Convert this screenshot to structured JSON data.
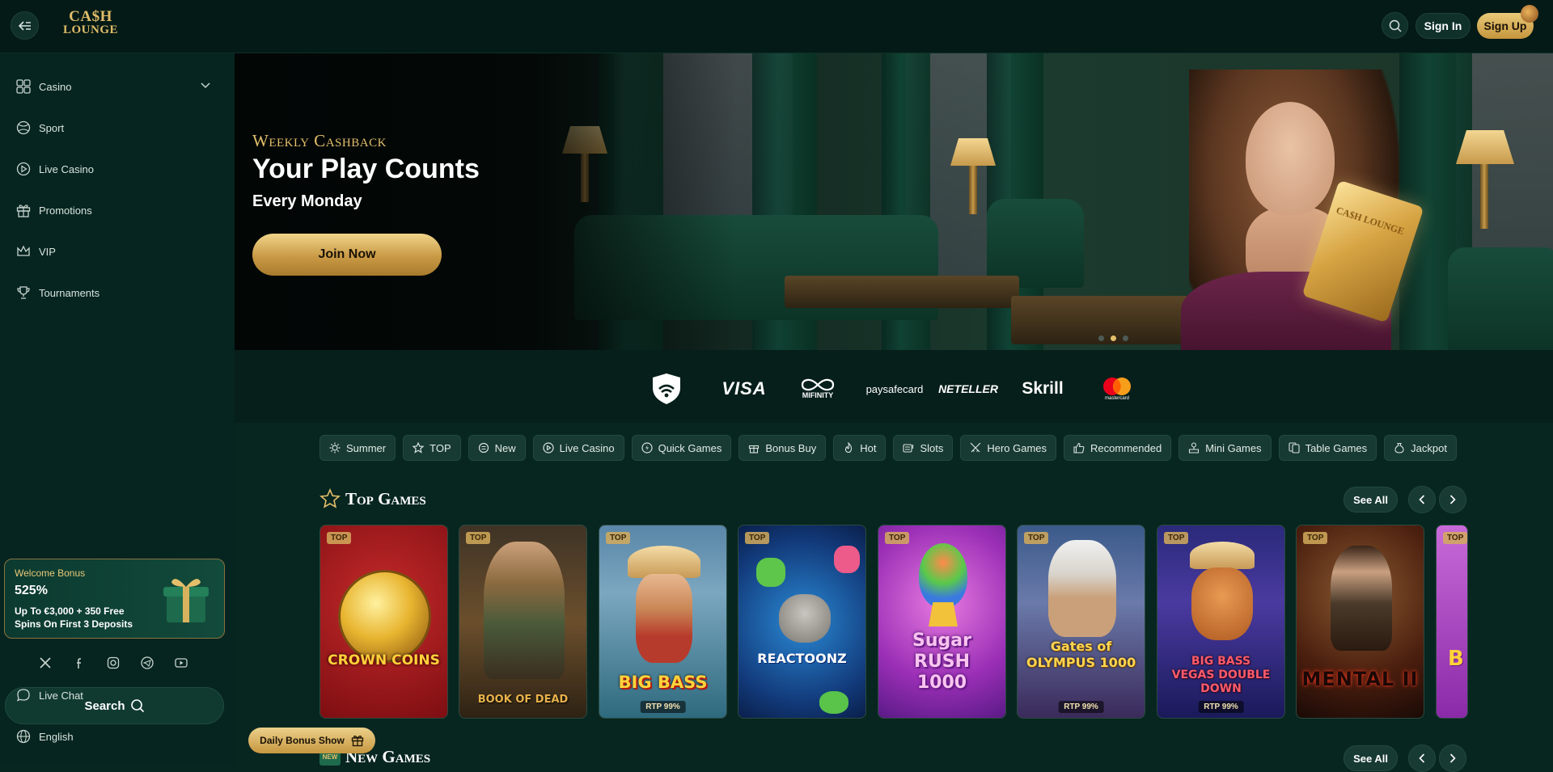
{
  "header": {
    "logo_line1": "CA$H",
    "logo_line2": "LOUNGE",
    "signin_label": "Sign In",
    "signup_label": "Sign Up"
  },
  "sidebar": {
    "items": [
      {
        "label": "Casino",
        "icon": "casino-icon"
      },
      {
        "label": "Sport",
        "icon": "sport-ball-icon"
      },
      {
        "label": "Live Casino",
        "icon": "play-circle-icon"
      },
      {
        "label": "Promotions",
        "icon": "gift-icon"
      },
      {
        "label": "VIP",
        "icon": "crown-icon"
      },
      {
        "label": "Tournaments",
        "icon": "trophy-icon"
      }
    ],
    "welcome": {
      "title": "Welcome Bonus",
      "amount": "525%",
      "description": "Up To €3,000 + 350 Free Spins On First 3 Deposits"
    },
    "socials": [
      "x-icon",
      "facebook-icon",
      "instagram-icon",
      "telegram-icon",
      "youtube-icon"
    ],
    "search_label": "Search",
    "bottom_items": [
      {
        "label": "Live Chat",
        "icon": "chat-icon"
      },
      {
        "label": "English",
        "icon": "globe-icon"
      }
    ]
  },
  "hero": {
    "kicker": "Weekly Cashback",
    "title": "Your Play Counts",
    "subtitle": "Every Monday",
    "cta": "Join Now",
    "goldbar_text": "CA$H LOUNGE",
    "slides": 1,
    "active_slide": 1
  },
  "payments": {
    "visa": "VISA",
    "mifinity": "MIFINITY",
    "paysafecard": "paysafecard",
    "neteller": "NETELLER",
    "skrill": "Skrill",
    "mastercard": "mastercard"
  },
  "categories": [
    {
      "label": "Summer",
      "icon": "sun-icon"
    },
    {
      "label": "TOP",
      "icon": "star-icon"
    },
    {
      "label": "New",
      "icon": "new-icon"
    },
    {
      "label": "Live Casino",
      "icon": "play-circle-icon"
    },
    {
      "label": "Quick Games",
      "icon": "bolt-icon"
    },
    {
      "label": "Bonus Buy",
      "icon": "gift-icon"
    },
    {
      "label": "Hot",
      "icon": "flame-icon"
    },
    {
      "label": "Slots",
      "icon": "slots-icon"
    },
    {
      "label": "Hero Games",
      "icon": "swords-icon"
    },
    {
      "label": "Recommended",
      "icon": "thumbs-up-icon"
    },
    {
      "label": "Mini Games",
      "icon": "joystick-icon"
    },
    {
      "label": "Table Games",
      "icon": "cards-icon"
    },
    {
      "label": "Jackpot",
      "icon": "money-bag-icon"
    }
  ],
  "top_games": {
    "title": "Top Games",
    "see_all": "See All",
    "games": [
      {
        "title": "CROWN COINS",
        "badge": "TOP",
        "rtp": ""
      },
      {
        "title": "BOOK OF DEAD",
        "badge": "TOP",
        "rtp": ""
      },
      {
        "title": "BIG BASS",
        "badge": "TOP",
        "rtp": "RTP 99%"
      },
      {
        "title": "REACTOONZ",
        "badge": "TOP",
        "rtp": ""
      },
      {
        "title": "Sugar RUSH 1000",
        "badge": "TOP",
        "rtp": ""
      },
      {
        "title": "Gates of OLYMPUS 1000",
        "badge": "TOP",
        "rtp": "RTP 99%"
      },
      {
        "title": "BIG BASS VEGAS DOUBLE DOWN",
        "badge": "TOP",
        "rtp": "RTP 99%"
      },
      {
        "title": "MENTAL II",
        "badge": "TOP",
        "rtp": ""
      },
      {
        "title": "B",
        "badge": "TOP",
        "rtp": ""
      }
    ]
  },
  "new_games": {
    "title": "New Games",
    "badge": "NEW",
    "see_all": "See All"
  },
  "daily_bonus": "Daily Bonus Show"
}
